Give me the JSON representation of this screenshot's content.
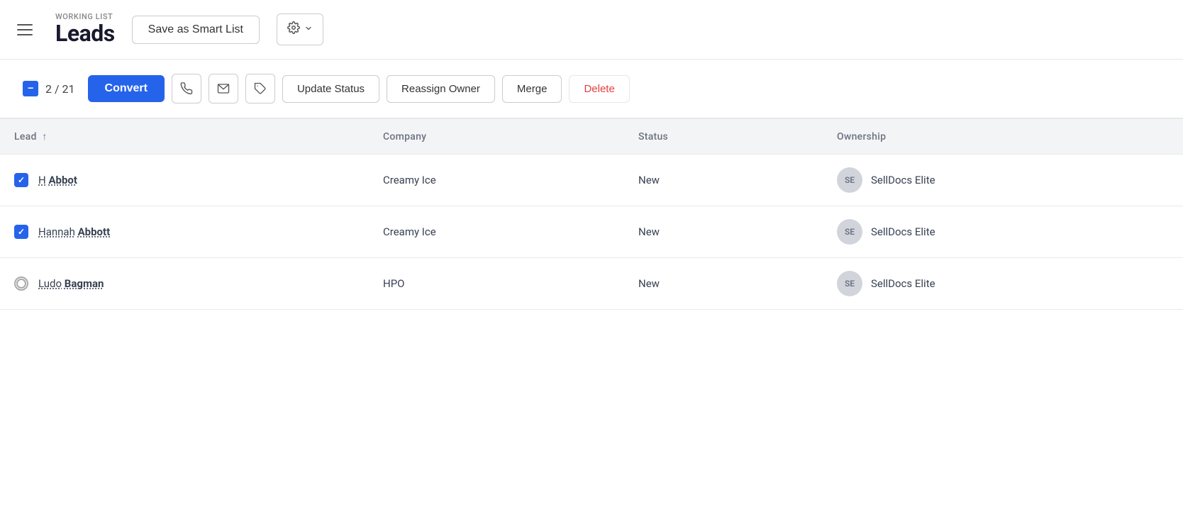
{
  "header": {
    "working_list_label": "WORKING LIST",
    "page_title": "Leads",
    "save_smart_list_label": "Save as Smart List"
  },
  "toolbar": {
    "selection_count": "2 / 21",
    "convert_label": "Convert",
    "update_status_label": "Update Status",
    "reassign_owner_label": "Reassign Owner",
    "merge_label": "Merge",
    "delete_label": "Delete"
  },
  "table": {
    "columns": [
      "Lead",
      "Company",
      "Status",
      "Ownership"
    ],
    "sort_col": "Lead",
    "sort_dir": "↑",
    "rows": [
      {
        "checked": true,
        "first_name": "H",
        "last_name": "Abbot",
        "company": "Creamy Ice",
        "status": "New",
        "avatar_initials": "SE",
        "ownership": "SellDocs Elite"
      },
      {
        "checked": true,
        "first_name": "Hannah",
        "last_name": "Abbott",
        "company": "Creamy Ice",
        "status": "New",
        "avatar_initials": "SE",
        "ownership": "SellDocs Elite"
      },
      {
        "checked": false,
        "first_name": "Ludo",
        "last_name": "Bagman",
        "company": "HPO",
        "status": "New",
        "avatar_initials": "SE",
        "ownership": "SellDocs Elite"
      }
    ]
  }
}
